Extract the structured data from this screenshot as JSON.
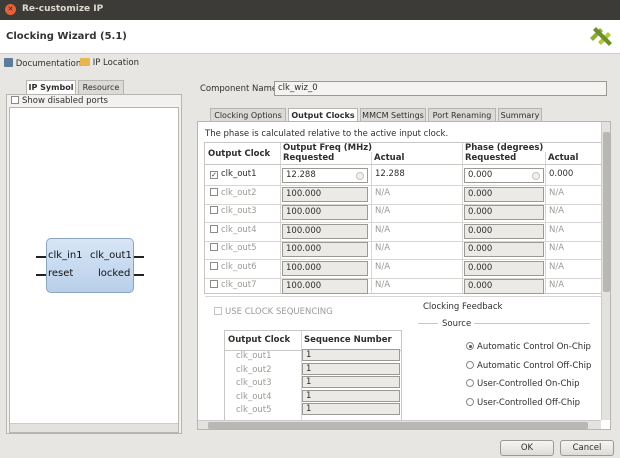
{
  "window": {
    "title": "Re-customize IP"
  },
  "header": {
    "title": "Clocking Wizard (5.1)"
  },
  "toolbar": {
    "documentation": "Documentation",
    "ip_location": "IP Location"
  },
  "left": {
    "tabs": [
      "IP Symbol",
      "Resource"
    ],
    "show_disabled": "Show disabled ports",
    "symbol": {
      "in1": "clk_in1",
      "out1": "clk_out1",
      "reset": "reset",
      "locked": "locked"
    }
  },
  "component": {
    "label": "Component Name",
    "value": "clk_wiz_0"
  },
  "tabs": [
    "Clocking Options",
    "Output Clocks",
    "MMCM Settings",
    "Port Renaming",
    "Summary"
  ],
  "note": "The phase is calculated relative to the active input clock.",
  "table": {
    "col_output": "Output Clock",
    "col_freq": "Output Freq (MHz)",
    "col_phase": "Phase (degrees)",
    "sub_requested": "Requested",
    "sub_actual": "Actual",
    "rows": [
      {
        "name": "clk_out1",
        "checked": "✓",
        "freq_req": "12.288",
        "freq_act": "12.288",
        "phase_req": "0.000",
        "phase_act": "0.000"
      },
      {
        "name": "clk_out2",
        "checked": "",
        "freq_req": "100.000",
        "freq_act": "N/A",
        "phase_req": "0.000",
        "phase_act": "N/A"
      },
      {
        "name": "clk_out3",
        "checked": "",
        "freq_req": "100.000",
        "freq_act": "N/A",
        "phase_req": "0.000",
        "phase_act": "N/A"
      },
      {
        "name": "clk_out4",
        "checked": "",
        "freq_req": "100.000",
        "freq_act": "N/A",
        "phase_req": "0.000",
        "phase_act": "N/A"
      },
      {
        "name": "clk_out5",
        "checked": "",
        "freq_req": "100.000",
        "freq_act": "N/A",
        "phase_req": "0.000",
        "phase_act": "N/A"
      },
      {
        "name": "clk_out6",
        "checked": "",
        "freq_req": "100.000",
        "freq_act": "N/A",
        "phase_req": "0.000",
        "phase_act": "N/A"
      },
      {
        "name": "clk_out7",
        "checked": "",
        "freq_req": "100.000",
        "freq_act": "N/A",
        "phase_req": "0.000",
        "phase_act": "N/A"
      }
    ]
  },
  "sequencing": {
    "label": "USE CLOCK SEQUENCING",
    "col_output": "Output Clock",
    "col_seq": "Sequence Number",
    "rows": [
      {
        "name": "clk_out1",
        "seq": "1"
      },
      {
        "name": "clk_out2",
        "seq": "1"
      },
      {
        "name": "clk_out3",
        "seq": "1"
      },
      {
        "name": "clk_out4",
        "seq": "1"
      },
      {
        "name": "clk_out5",
        "seq": "1"
      }
    ]
  },
  "feedback": {
    "title": "Clocking Feedback",
    "source": "Source",
    "options": [
      "Automatic Control On-Chip",
      "Automatic Control Off-Chip",
      "User-Controlled On-Chip",
      "User-Controlled Off-Chip"
    ],
    "selected": 0
  },
  "buttons": {
    "ok": "OK",
    "cancel": "Cancel"
  }
}
